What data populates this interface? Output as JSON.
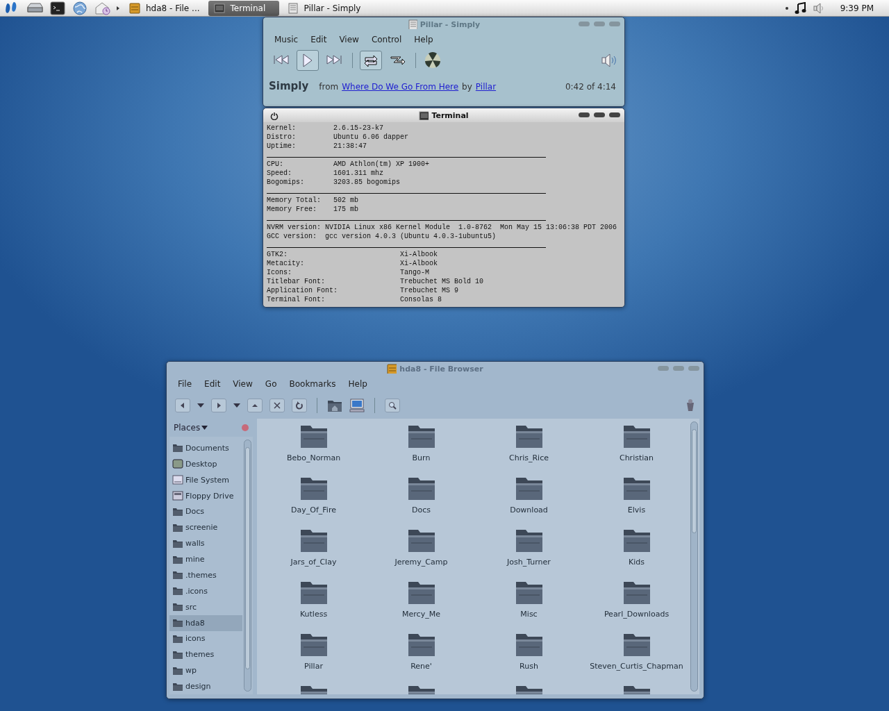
{
  "panel": {
    "tasks": [
      {
        "label": "hda8 - File ...",
        "kind": "files",
        "selected": false
      },
      {
        "label": "Terminal",
        "kind": "terminal",
        "selected": true
      },
      {
        "label": "Pillar - Simply",
        "kind": "player",
        "selected": false
      }
    ],
    "clock": "9:39 PM"
  },
  "player": {
    "title": "Pillar - Simply",
    "menu": [
      "Music",
      "Edit",
      "View",
      "Control",
      "Help"
    ],
    "controls": [
      {
        "kind": "previous",
        "on": false
      },
      {
        "kind": "play",
        "on": true
      },
      {
        "kind": "next",
        "on": false
      },
      {
        "kind": "repeat",
        "on": true
      },
      {
        "kind": "shuffle",
        "on": false
      }
    ],
    "track": "Simply",
    "from": "from",
    "album": "Where Do We Go From Here",
    "by": "by",
    "artist": "Pillar",
    "time": "0:42 of 4:14"
  },
  "terminal": {
    "title": "Terminal",
    "lines": [
      {
        "kind": "text",
        "text": "Kernel:         2.6.15-23-k7"
      },
      {
        "kind": "text",
        "text": "Distro:         Ubuntu 6.06 dapper"
      },
      {
        "kind": "text",
        "text": "Uptime:         21:38:47"
      },
      {
        "kind": "rule"
      },
      {
        "kind": "text",
        "text": "CPU:            AMD Athlon(tm) XP 1900+"
      },
      {
        "kind": "text",
        "text": "Speed:          1601.311 mhz"
      },
      {
        "kind": "text",
        "text": "Bogomips:       3203.85 bogomips"
      },
      {
        "kind": "rule"
      },
      {
        "kind": "text",
        "text": "Memory Total:   502 mb"
      },
      {
        "kind": "text",
        "text": "Memory Free:    175 mb"
      },
      {
        "kind": "rule"
      },
      {
        "kind": "text",
        "text": "NVRM version: NVIDIA Linux x86 Kernel Module  1.0-8762  Mon May 15 13:06:38 PDT 2006"
      },
      {
        "kind": "text",
        "text": "GCC version:  gcc version 4.0.3 (Ubuntu 4.0.3-1ubuntu5)"
      },
      {
        "kind": "rule"
      },
      {
        "kind": "text",
        "text": "GTK2:                           Xi-Albook"
      },
      {
        "kind": "text",
        "text": "Metacity:                       Xi-Albook"
      },
      {
        "kind": "text",
        "text": "Icons:                          Tango-M"
      },
      {
        "kind": "text",
        "text": "Titlebar Font:                  Trebuchet MS Bold 10"
      },
      {
        "kind": "text",
        "text": "Application Font:               Trebuchet MS 9"
      },
      {
        "kind": "text",
        "text": "Terminal Font:                  Consolas 8"
      }
    ]
  },
  "files": {
    "title": "hda8 - File Browser",
    "menu": [
      "File",
      "Edit",
      "View",
      "Go",
      "Bookmarks",
      "Help"
    ],
    "places": "Places",
    "sidebar": [
      {
        "label": "Documents",
        "kind": "folder",
        "selected": false
      },
      {
        "label": "Desktop",
        "kind": "desktop",
        "selected": false
      },
      {
        "label": "File System",
        "kind": "drive",
        "selected": false
      },
      {
        "label": "Floppy Drive",
        "kind": "floppy",
        "selected": false
      },
      {
        "label": "Docs",
        "kind": "folder",
        "selected": false
      },
      {
        "label": "screenie",
        "kind": "folder",
        "selected": false
      },
      {
        "label": "walls",
        "kind": "folder",
        "selected": false
      },
      {
        "label": "mine",
        "kind": "folder",
        "selected": false
      },
      {
        "label": ".themes",
        "kind": "folder",
        "selected": false
      },
      {
        "label": ".icons",
        "kind": "folder",
        "selected": false
      },
      {
        "label": "src",
        "kind": "folder",
        "selected": false
      },
      {
        "label": "hda8",
        "kind": "folder",
        "selected": true
      },
      {
        "label": "icons",
        "kind": "folder",
        "selected": false
      },
      {
        "label": "themes",
        "kind": "folder",
        "selected": false
      },
      {
        "label": "wp",
        "kind": "folder",
        "selected": false
      },
      {
        "label": "design",
        "kind": "folder",
        "selected": false
      }
    ],
    "folders": [
      "Bebo_Norman",
      "Burn",
      "Chris_Rice",
      "Christian",
      "Day_Of_Fire",
      "Docs",
      "Download",
      "Elvis",
      "Jars_of_Clay",
      "Jeremy_Camp",
      "Josh_Turner",
      "Kids",
      "Kutless",
      "Mercy_Me",
      "Misc",
      "Pearl_Downloads",
      "Pillar",
      "Rene'",
      "Rush",
      "Steven_Curtis_Chapman"
    ]
  }
}
